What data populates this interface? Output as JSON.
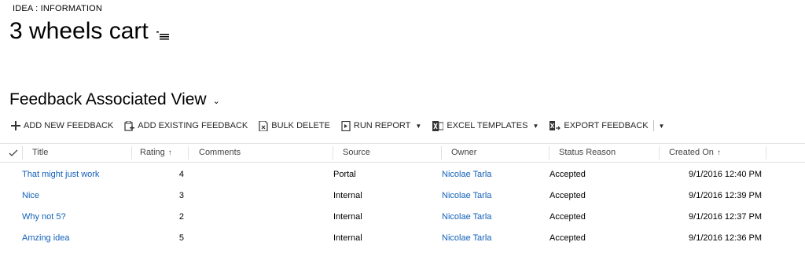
{
  "header": {
    "entity_type": "IDEA : INFORMATION",
    "record_title": "3 wheels cart"
  },
  "view": {
    "title": "Feedback Associated View"
  },
  "toolbar": {
    "add_new": "ADD NEW FEEDBACK",
    "add_existing": "ADD EXISTING FEEDBACK",
    "bulk_delete": "BULK DELETE",
    "run_report": "RUN REPORT",
    "excel_templates": "EXCEL TEMPLATES",
    "export": "EXPORT FEEDBACK"
  },
  "grid": {
    "columns": [
      "Title",
      "Rating",
      "Comments",
      "Source",
      "Owner",
      "Status Reason",
      "Created On"
    ],
    "sort_icon": "↑",
    "rows": [
      {
        "title": "That might just work",
        "rating": "4",
        "comments": "",
        "source": "Portal",
        "owner": "Nicolae Tarla",
        "status": "Accepted",
        "created": "9/1/2016 12:40 PM"
      },
      {
        "title": "Nice",
        "rating": "3",
        "comments": "",
        "source": "Internal",
        "owner": "Nicolae Tarla",
        "status": "Accepted",
        "created": "9/1/2016 12:39 PM"
      },
      {
        "title": "Why not 5?",
        "rating": "2",
        "comments": "",
        "source": "Internal",
        "owner": "Nicolae Tarla",
        "status": "Accepted",
        "created": "9/1/2016 12:37 PM"
      },
      {
        "title": "Amzing idea",
        "rating": "5",
        "comments": "",
        "source": "Internal",
        "owner": "Nicolae Tarla",
        "status": "Accepted",
        "created": "9/1/2016 12:36 PM"
      }
    ]
  },
  "colors": {
    "link": "#1160b7",
    "border": "#e1e1e1"
  }
}
